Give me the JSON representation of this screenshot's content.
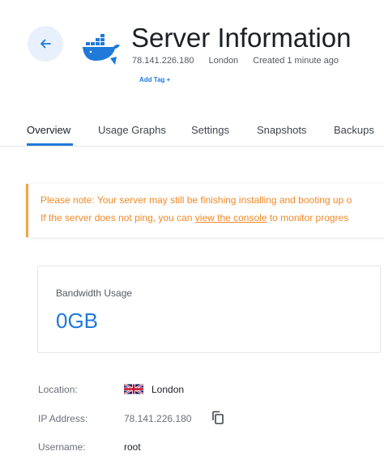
{
  "header": {
    "title": "Server Information",
    "ip": "78.141.226.180",
    "location": "London",
    "created": "Created 1 minute ago",
    "add_tag": "Add Tag +"
  },
  "tabs": [
    {
      "label": "Overview",
      "active": true
    },
    {
      "label": "Usage Graphs",
      "active": false
    },
    {
      "label": "Settings",
      "active": false
    },
    {
      "label": "Snapshots",
      "active": false
    },
    {
      "label": "Backups",
      "active": false
    }
  ],
  "notice": {
    "line1": "Please note: Your server may still be finishing installing and booting up o",
    "line2_before": "If the server does not ping, you can ",
    "line2_link": "view the console",
    "line2_after": " to monitor progres"
  },
  "bandwidth": {
    "label": "Bandwidth Usage",
    "value": "0GB"
  },
  "details": {
    "location": {
      "label": "Location:",
      "value": "London"
    },
    "ip": {
      "label": "IP Address:",
      "value": "78.141.226.180"
    },
    "username": {
      "label": "Username:",
      "value": "root"
    }
  },
  "colors": {
    "accent": "#1f7ad9",
    "notice": "#f08a2a",
    "back_button_bg": "#e8f1fb"
  },
  "icons": {
    "back": "arrow-left-icon",
    "server": "docker-whale-icon",
    "flag": "uk-flag-icon",
    "copy": "copy-icon"
  }
}
